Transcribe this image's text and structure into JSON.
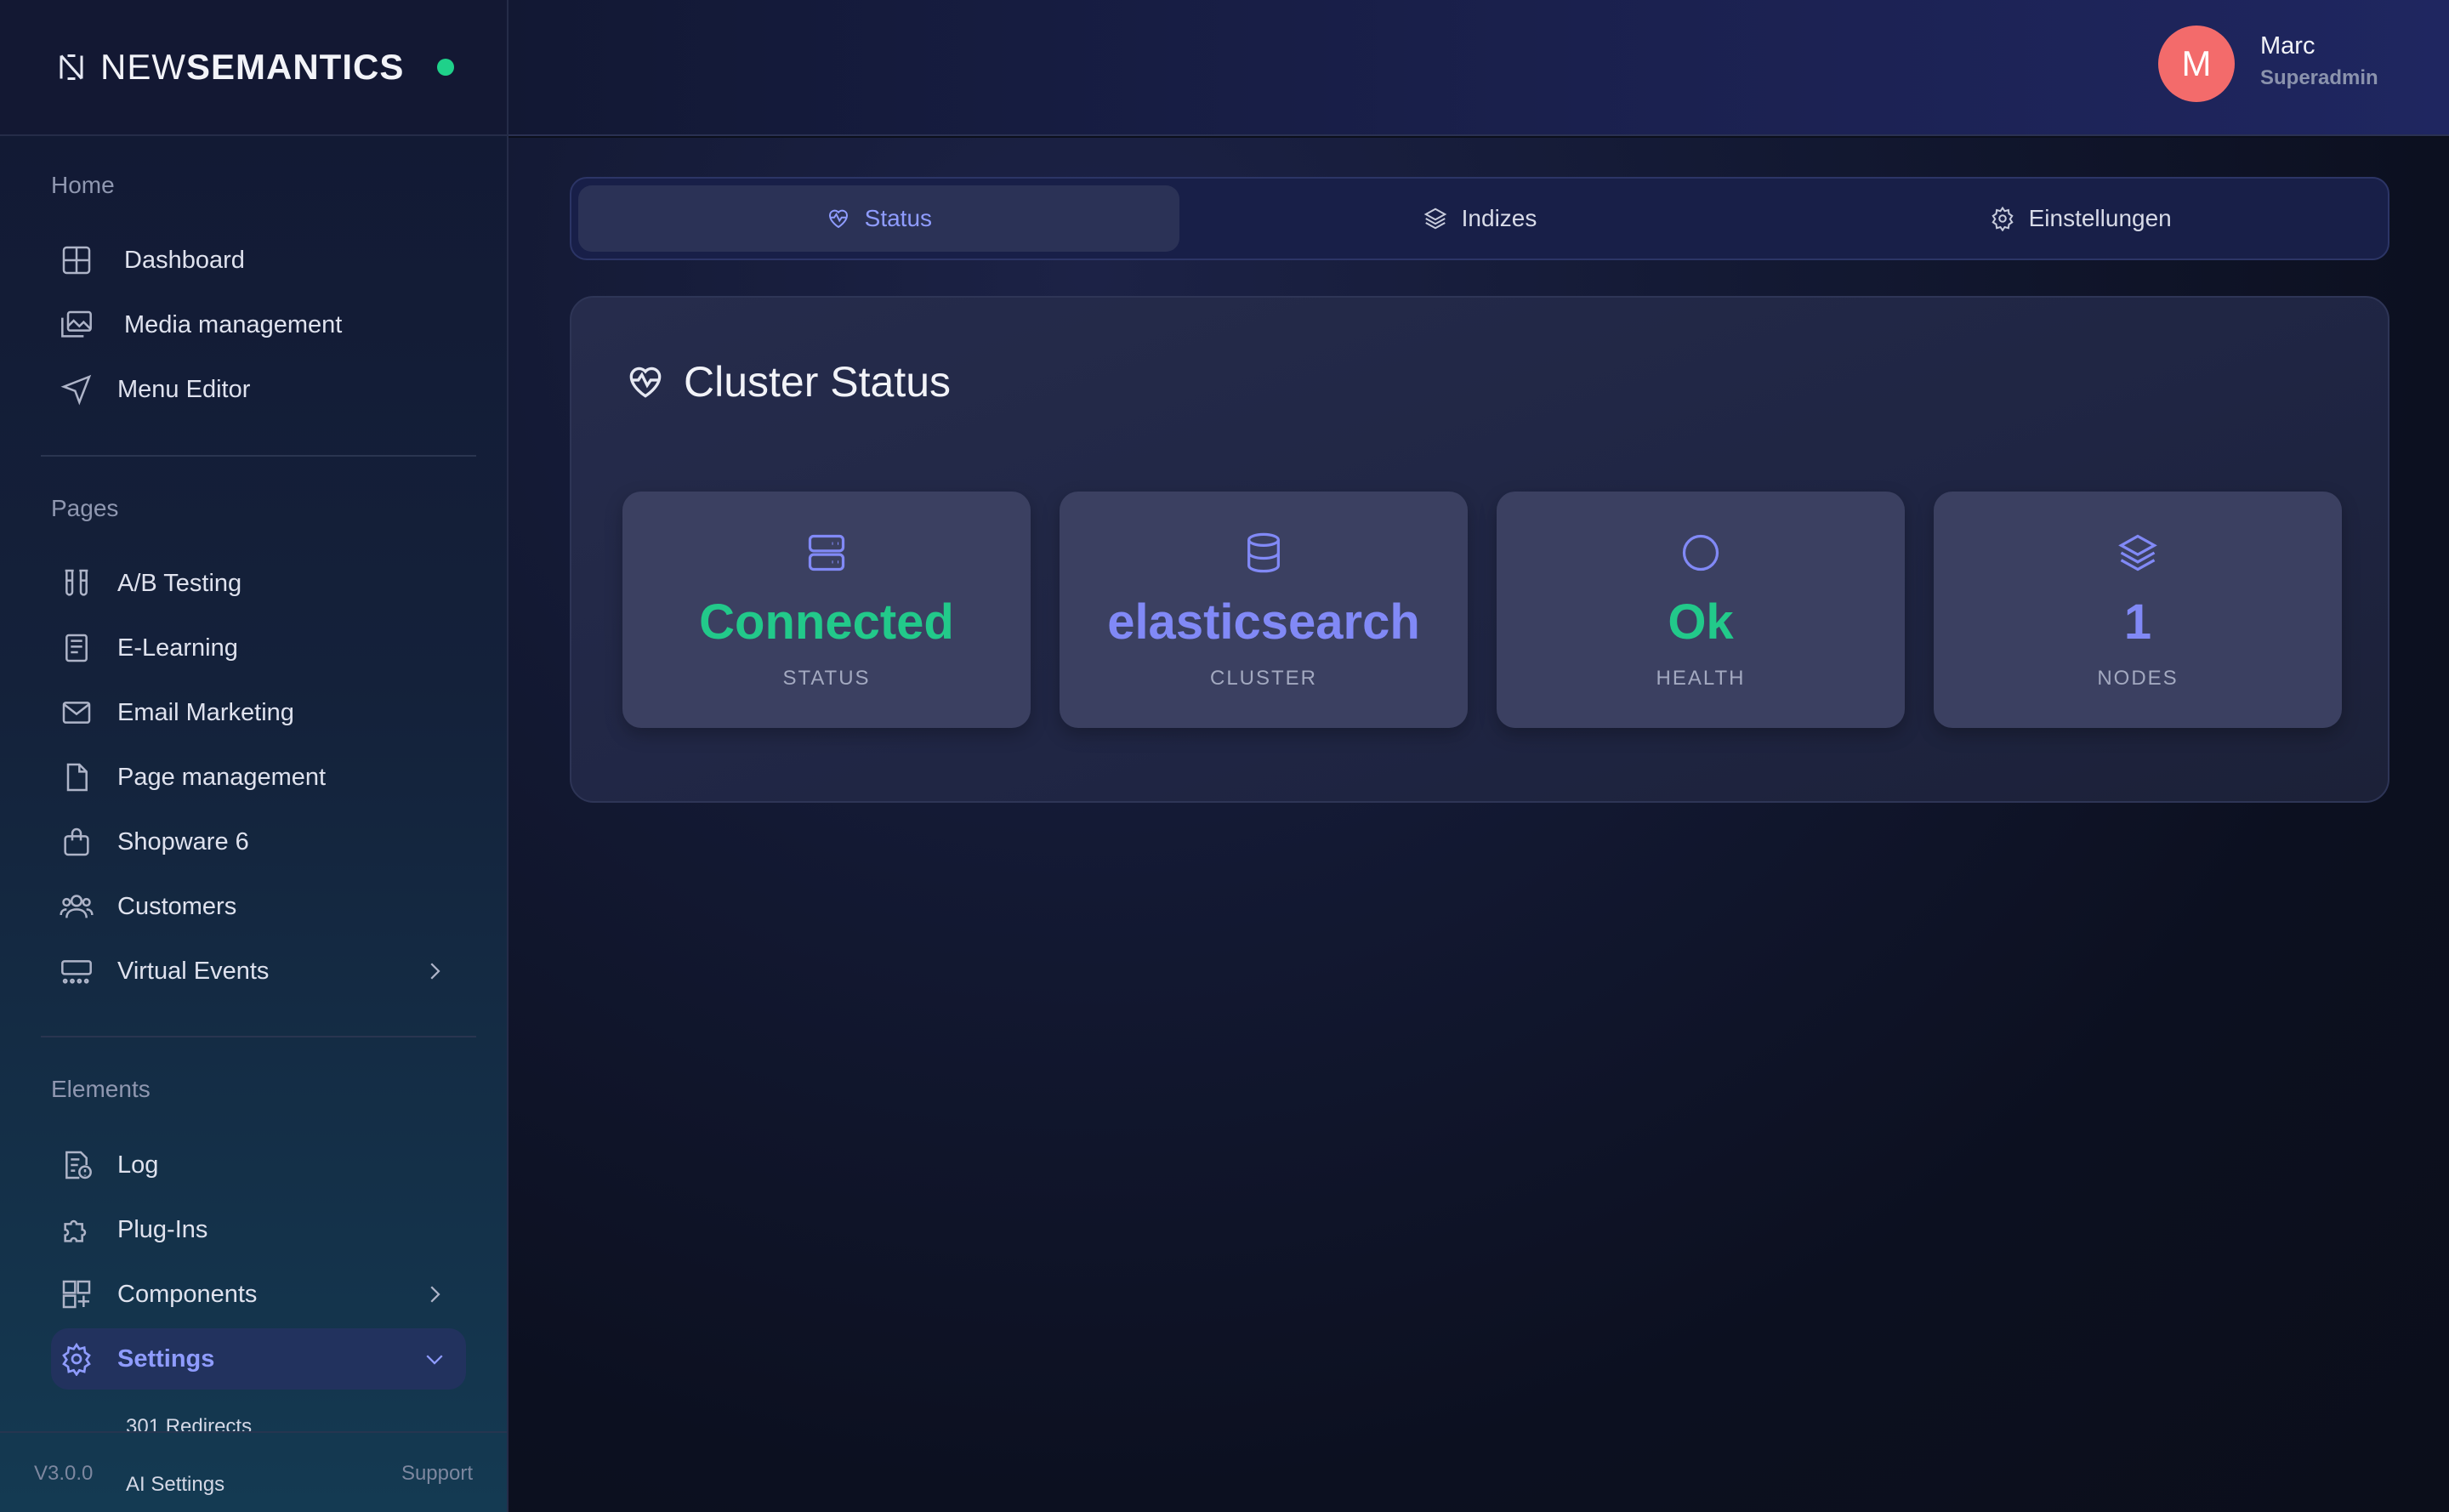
{
  "brand": {
    "thin": "NEW",
    "bold": "SEMANTICS"
  },
  "sidebar": {
    "sections": [
      {
        "label": "Home"
      },
      {
        "label": "Pages"
      },
      {
        "label": "Elements"
      }
    ],
    "items": [
      {
        "label": "Dashboard",
        "icon": "dashboard-grid-icon"
      },
      {
        "label": "Media management",
        "icon": "images-icon"
      },
      {
        "label": "Menu Editor",
        "icon": "navigation-arrow-icon"
      },
      {
        "label": "A/B Testing",
        "icon": "test-tubes-icon"
      },
      {
        "label": "E-Learning",
        "icon": "book-icon"
      },
      {
        "label": "Email Marketing",
        "icon": "mail-icon"
      },
      {
        "label": "Page management",
        "icon": "file-icon"
      },
      {
        "label": "Shopware 6",
        "icon": "shopping-bag-icon"
      },
      {
        "label": "Customers",
        "icon": "users-icon"
      },
      {
        "label": "Virtual Events",
        "icon": "events-icon"
      },
      {
        "label": "Log",
        "icon": "log-icon"
      },
      {
        "label": "Plug-Ins",
        "icon": "puzzle-icon"
      },
      {
        "label": "Components",
        "icon": "components-icon"
      },
      {
        "label": "Settings",
        "icon": "gear-icon"
      }
    ],
    "settings_sub": [
      "301 Redirects",
      "AI Settings"
    ],
    "footer": {
      "version": "V3.0.0",
      "support": "Support"
    }
  },
  "user": {
    "initial": "M",
    "name": "Marc",
    "role": "Superadmin"
  },
  "tabs": [
    {
      "label": "Status",
      "icon": "heart-pulse-icon"
    },
    {
      "label": "Indizes",
      "icon": "layers-icon"
    },
    {
      "label": "Einstellungen",
      "icon": "gear-icon"
    }
  ],
  "cluster": {
    "title": "Cluster Status",
    "stats": [
      {
        "value": "Connected",
        "label": "STATUS",
        "icon": "server-icon",
        "color": "#22c98a"
      },
      {
        "value": "elasticsearch",
        "label": "CLUSTER",
        "icon": "database-icon",
        "color": "#8189f6"
      },
      {
        "value": "Ok",
        "label": "HEALTH",
        "icon": "circle-icon",
        "color": "#22c98a"
      },
      {
        "value": "1",
        "label": "NODES",
        "icon": "layers-icon",
        "color": "#8189f6"
      }
    ]
  }
}
